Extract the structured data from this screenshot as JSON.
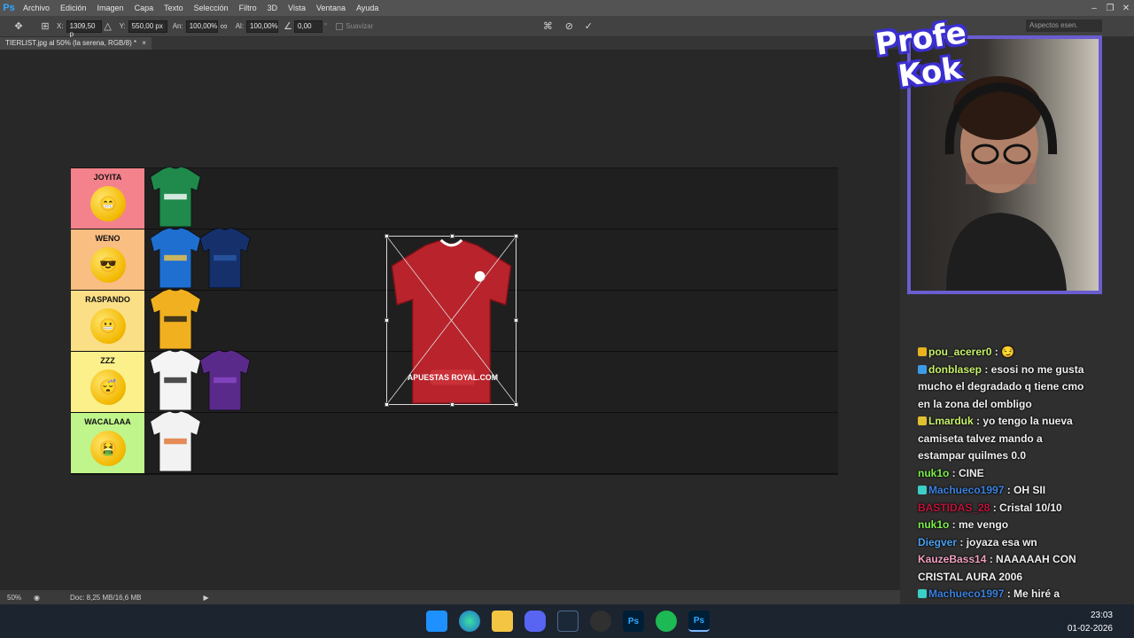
{
  "menubar": {
    "app_logo": "Ps",
    "items": [
      "Archivo",
      "Edición",
      "Imagen",
      "Capa",
      "Texto",
      "Selección",
      "Filtro",
      "3D",
      "Vista",
      "Ventana",
      "Ayuda"
    ],
    "window_controls": [
      "–",
      "❐",
      "✕"
    ]
  },
  "options": {
    "x_label": "X:",
    "x_value": "1309,50 p",
    "y_label": "Y:",
    "y_value": "550,00 px",
    "w_label": "An:",
    "w_value": "100,00%",
    "h_label": "Al:",
    "h_value": "100,00%",
    "angle_value": "0,00",
    "angle_unit": "°",
    "smooth_label": "Suavizar",
    "workspace": "Aspectos esen."
  },
  "document": {
    "tab_title": "TIERLIST.jpg al 50% (la serena, RGB/8) *"
  },
  "tierlist": {
    "tiers": [
      {
        "name": "JOYITA",
        "color": "#f4828c",
        "face": "😁"
      },
      {
        "name": "WENO",
        "color": "#f9be82",
        "face": "😎"
      },
      {
        "name": "RASPANDO",
        "color": "#fbdf86",
        "face": "😬"
      },
      {
        "name": "ZZZ",
        "color": "#fbf08a",
        "face": "😴"
      },
      {
        "name": "WACALAAA",
        "color": "#bff58a",
        "face": "🤮"
      }
    ],
    "featured_jersey_text": "APUESTAS ROYAL.COM"
  },
  "status": {
    "zoom": "50%",
    "doc_info": "Doc: 8,25 MB/16,6 MB"
  },
  "overlay": {
    "logo_line1": "Profe",
    "logo_line2": "Kok"
  },
  "chat": [
    {
      "user": "pou_acerer0",
      "color": "#c7f26a",
      "msg": " : 😏",
      "badge": "#e8b120"
    },
    {
      "user": "donblasep",
      "color": "#c7f26a",
      "msg": " : esosi no me gusta mucho el degradado q tiene cmo en la zona del ombligo",
      "badge": "#3c9be8"
    },
    {
      "user": "Lmarduk",
      "color": "#c7f26a",
      "msg": " : yo tengo la nueva camiseta talvez mando a estampar quilmes 0.0",
      "badge": "#e0c030"
    },
    {
      "user": "nuk1o",
      "color": "#7cf04a",
      "msg": " : CINE",
      "badge": ""
    },
    {
      "user": "Machueco1997",
      "color": "#3b82e0",
      "msg": " : OH SII",
      "badge": "#3ad0c8"
    },
    {
      "user": "BASTIDAS_28",
      "color": "#c0143c",
      "msg": " : Cristal 10/10",
      "badge": ""
    },
    {
      "user": "nuk1o",
      "color": "#7cf04a",
      "msg": " : me vengo",
      "badge": ""
    },
    {
      "user": "Diegver",
      "color": "#4aa0f0",
      "msg": " : joyaza esa wn",
      "badge": ""
    },
    {
      "user": "KauzeBass14",
      "color": "#f0a0c0",
      "msg": " : NAAAAAH CON CRISTAL AURA 2006",
      "badge": ""
    },
    {
      "user": "Machueco1997",
      "color": "#3b82e0",
      "msg": " : Me hiré a pajear con la imagen",
      "badge": "#3ad0c8"
    }
  ],
  "taskbar": {
    "time": "23:03",
    "date": "01-02-2026"
  }
}
